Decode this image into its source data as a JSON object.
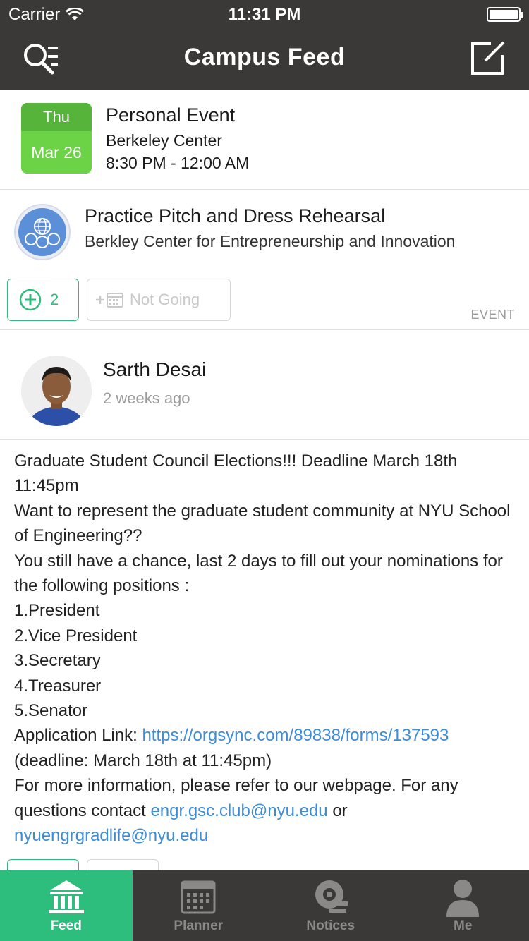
{
  "status_bar": {
    "carrier": "Carrier",
    "time": "11:31 PM"
  },
  "nav": {
    "title": "Campus Feed",
    "left_icon": "search-list-icon",
    "right_icon": "compose-icon"
  },
  "personal_event": {
    "day": "Thu",
    "date": "Mar 26",
    "title": "Personal Event",
    "location": "Berkeley Center",
    "time": "8:30 PM - 12:00 AM"
  },
  "event_card": {
    "title": "Practice Pitch and Dress Rehearsal",
    "organization": "Berkley Center for Entrepreneurship and Innovation",
    "plus_count": "2",
    "rsvp_label": "Not Going",
    "type_tag": "EVENT"
  },
  "post": {
    "author": "Sarth Desai",
    "time_ago": "2 weeks ago",
    "lines": [
      "Graduate Student Council Elections!!! Deadline March 18th 11:45pm",
      "Want to represent the graduate student community at NYU School of Engineering??",
      "You still have a chance, last 2 days to fill out your nominations for the following positions :",
      "1.President",
      "2.Vice President",
      "3.Secretary",
      "4.Treasurer",
      "5.Senator"
    ],
    "app_link_prefix": "Application Link: ",
    "app_link": "https://orgsync.com/89838/forms/137593",
    "deadline_note": "(deadline: March 18th at 11:45pm)",
    "info_text": "For more information, please refer to our webpage. For any questions contact ",
    "email1": "engr.gsc.club@nyu.edu",
    "or_text": " or ",
    "email2": "nyuengrgradlife@nyu.edu"
  },
  "tabs": [
    {
      "label": "Feed",
      "icon": "feed-building-icon",
      "active": true
    },
    {
      "label": "Planner",
      "icon": "calendar-icon",
      "active": false
    },
    {
      "label": "Notices",
      "icon": "bell-icon",
      "active": false
    },
    {
      "label": "Me",
      "icon": "person-icon",
      "active": false
    }
  ],
  "colors": {
    "accent": "#2dbd7d",
    "nav_bg": "#3b3937",
    "calendar_green": "#6cd346",
    "link": "#3f8bd6"
  }
}
